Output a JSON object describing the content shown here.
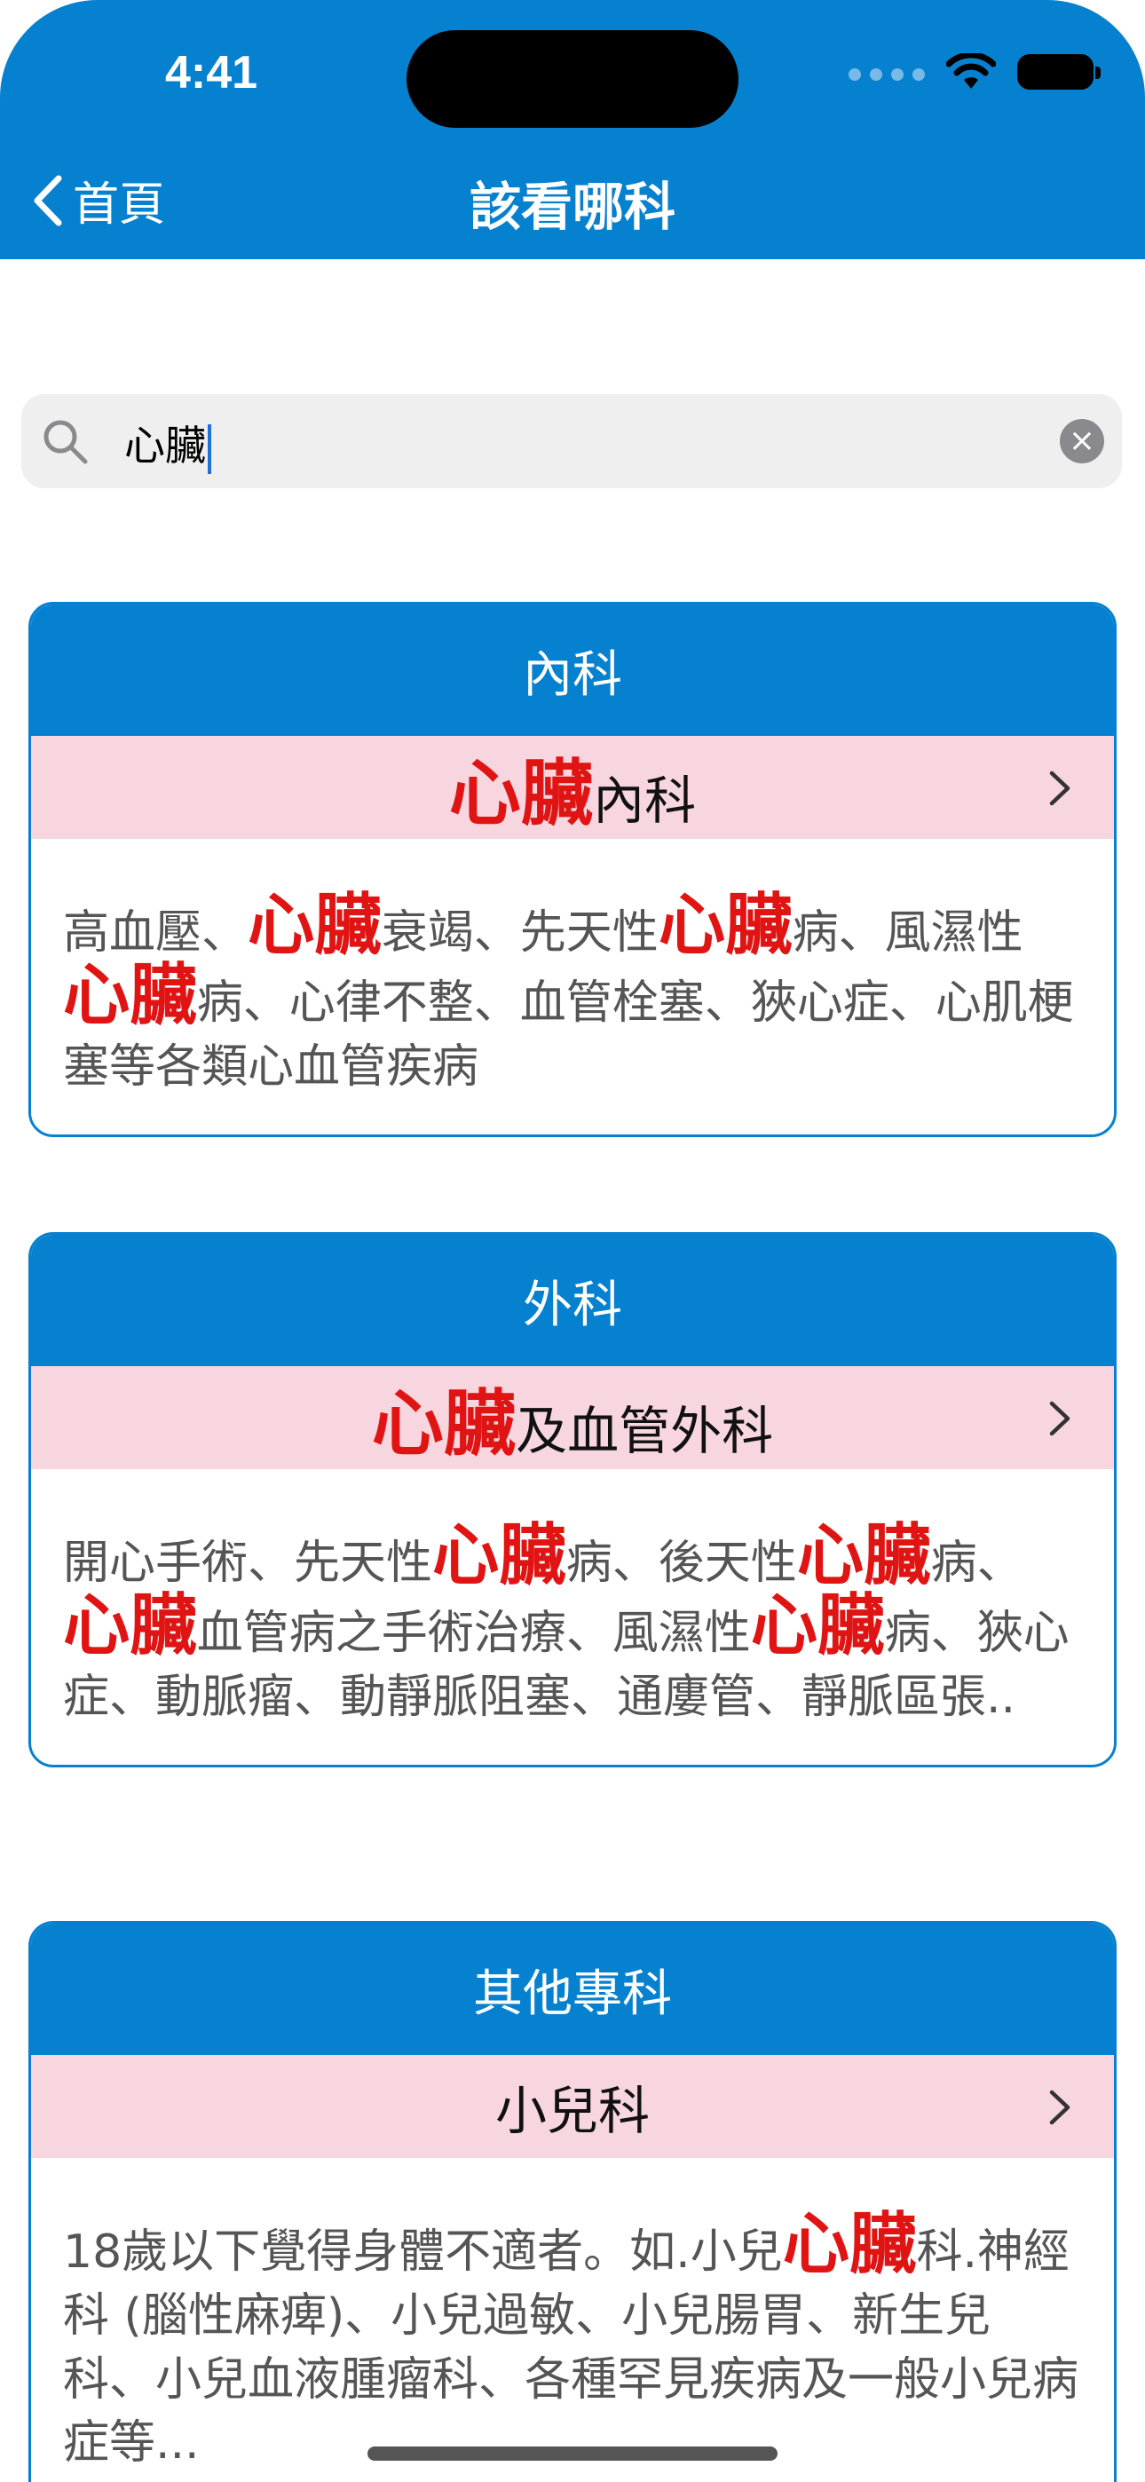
{
  "status": {
    "time": "4:41"
  },
  "nav": {
    "back_label": "首頁",
    "title": "該看哪科"
  },
  "search": {
    "value": "心臟"
  },
  "cards": [
    {
      "header": "內科",
      "row": {
        "parts": [
          "心臟",
          "內科"
        ]
      },
      "desc": [
        "高血壓、",
        "心臟",
        "衰竭、先天性",
        "心臟",
        "病、風濕性",
        "心臟",
        "病、心律不整、血管栓塞、狹心症、心肌梗塞等各類心血管疾病"
      ]
    },
    {
      "header": "外科",
      "row": {
        "parts": [
          "心臟",
          "及血管外科"
        ]
      },
      "desc": [
        "開心手術、先天性",
        "心臟",
        "病、後天性",
        "心臟",
        "病、",
        "心臟",
        "血管病之手術治療、風濕性",
        "心臟",
        "病、狹心症、動脈瘤、動靜脈阻塞、通廔管、靜脈區張.."
      ]
    },
    {
      "header": "其他專科",
      "row": {
        "parts": [
          "小兒科"
        ]
      },
      "desc": [
        "18歲以下覺得身體不適者。如.小兒",
        "心臟",
        "科.神經科 (腦性麻痺)、小兒過敏、小兒腸胃、新生兒科、小兒血液腫瘤科、各種罕見疾病及一般小兒病症等..."
      ]
    }
  ],
  "colors": {
    "accent": "#0681cf",
    "highlight": "#e11414",
    "row_bg": "#f7d6e0"
  }
}
